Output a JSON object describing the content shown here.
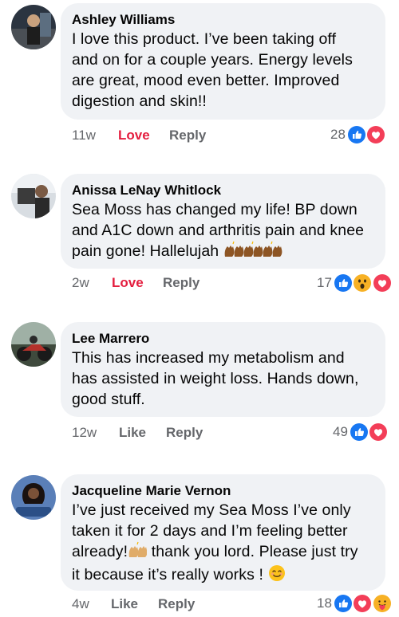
{
  "comments": [
    {
      "author": "Ashley Williams",
      "text_lines": [
        "I love this product. I’ve been taking off",
        "and on for a couple years. Energy levels",
        "are great, mood even better. Improved",
        "digestion and skin!!"
      ],
      "time": "11w",
      "action_label": "Love",
      "reply_label": "Reply",
      "reaction_count": "28",
      "reactions": [
        "like-icon",
        "love-icon"
      ]
    },
    {
      "author": "Anissa LeNay Whitlock",
      "text_lines": [
        "Sea Moss has changed my life! BP down",
        "and A1C down and arthritis pain and knee",
        "pain gone! Hallelujah"
      ],
      "time": "2w",
      "action_label": "Love",
      "reply_label": "Reply",
      "reaction_count": "17",
      "reactions": [
        "like-icon",
        "wow-icon",
        "love-icon"
      ]
    },
    {
      "author": "Lee Marrero",
      "text_lines": [
        "This has increased my metabolism and",
        "has assisted in weight loss. Hands down,",
        "good stuff."
      ],
      "time": "12w",
      "action_label": "Like",
      "reply_label": "Reply",
      "reaction_count": "49",
      "reactions": [
        "like-icon",
        "love-icon"
      ]
    },
    {
      "author": "Jacqueline Marie Vernon",
      "text_lines": [
        "I’ve just received my Sea Moss I’ve only",
        "taken it for 2 days and I’m feeling better",
        "already!",
        " thank you lord. Please just try",
        "it because it’s really works ! "
      ],
      "time": "4w",
      "action_label": "Like",
      "reply_label": "Reply",
      "reaction_count": "18",
      "reactions": [
        "like-icon",
        "love-icon",
        "care-icon"
      ]
    }
  ],
  "colors": {
    "bubble": "#f0f2f5",
    "meta_text": "#65676b",
    "love": "#e41e3f",
    "like_blue": "#1877f2",
    "author": "#050505"
  }
}
